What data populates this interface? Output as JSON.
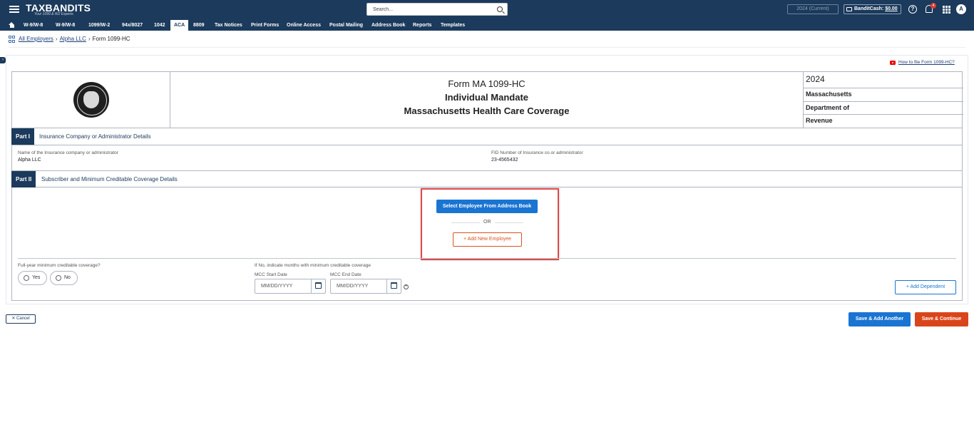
{
  "header": {
    "logo_text": "TAXBANDITS",
    "tagline": "Your 1099 & W2 Experts",
    "search_placeholder": "Search...",
    "year_select": "2024 (Current)",
    "bandit_cash_label": "BanditCash:",
    "bandit_cash_value": "$0.00",
    "notification_count": "4",
    "avatar_initial": "A",
    "help_glyph": "?"
  },
  "nav": {
    "tabs": [
      "W-9/W-8",
      "W-9/W-8",
      "1099/W-2",
      "94x/8027",
      "1042",
      "ACA",
      "8809",
      "Tax Notices",
      "Print Forms",
      "Online Access",
      "Postal Mailing",
      "Address Book",
      "Reports",
      "Templates"
    ],
    "active_tab": "ACA"
  },
  "breadcrumb": {
    "items": [
      "All Employers",
      "Alpha LLC",
      "Form 1099-HC"
    ]
  },
  "form": {
    "how_to_link": "How to file Form 1099-HC?",
    "title_line1": "Form MA 1099-HC",
    "title_line2": "Individual Mandate",
    "title_line3": "Massachusetts Health Care Coverage",
    "year": "2024",
    "state": "Massachusetts",
    "dept_line1": "Department of",
    "dept_line2": "Revenue",
    "part1": {
      "badge": "Part I",
      "label": "Insurance Company or Administrator Details",
      "name_label": "Name of the Insurance company or administrator",
      "name_value": "Alpha LLC",
      "fid_label": "FID Number of Insurance co.or administrator",
      "fid_value": "23-4565432"
    },
    "part2": {
      "badge": "Part II",
      "label": "Subscriber and Minimum Creditable Coverage Details",
      "select_employee_button": "Select Employee From Address Book",
      "or_text": "OR",
      "add_employee_button": "+  Add New Employee",
      "full_year_label": "Full-year minimum creditable coverage?",
      "yes_label": "Yes",
      "no_label": "No",
      "months_label": "If No, indicate months with minimum creditable coverage",
      "mcc_start_label": "MCC Start Date",
      "mcc_end_label": "MCC End Date",
      "date_placeholder": "MM/DD/YYYY",
      "add_dependent_button": "+  Add Dependent"
    }
  },
  "footer": {
    "cancel_button": "✕  Cancel",
    "save_add_another_button": "Save & Add Another",
    "save_continue_button": "Save & Continue"
  },
  "colors": {
    "header_bg": "#1b3a5c",
    "primary_blue": "#1a74d2",
    "orange": "#d9451a",
    "highlight_red": "#e04848"
  }
}
